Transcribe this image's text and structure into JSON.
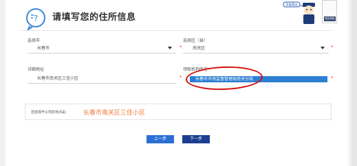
{
  "header": {
    "title": "请填写您的住所信息",
    "badge": "平安网言",
    "thumb_label": "首页导航"
  },
  "form": {
    "city_label": "选择市",
    "city_value": "长春市",
    "district_label": "选择区（县）",
    "district_value": "南关区",
    "address_label": "详细地址",
    "address_value": "长春市南关区三佳小区",
    "office_label": "领取机构所在",
    "office_value": "长春市市场监督管理局南关分局",
    "required_mark": "*"
  },
  "summary": {
    "label": "您选择开公司的地点是：",
    "value": "长春市南关区三佳小区"
  },
  "buttons": {
    "prev": "上一步",
    "next": "下一步"
  },
  "colors": {
    "accent": "#2b6fd6",
    "highlight": "#2d7fd3",
    "annotation": "#d40d0d",
    "summary_value": "#f07a3a"
  }
}
